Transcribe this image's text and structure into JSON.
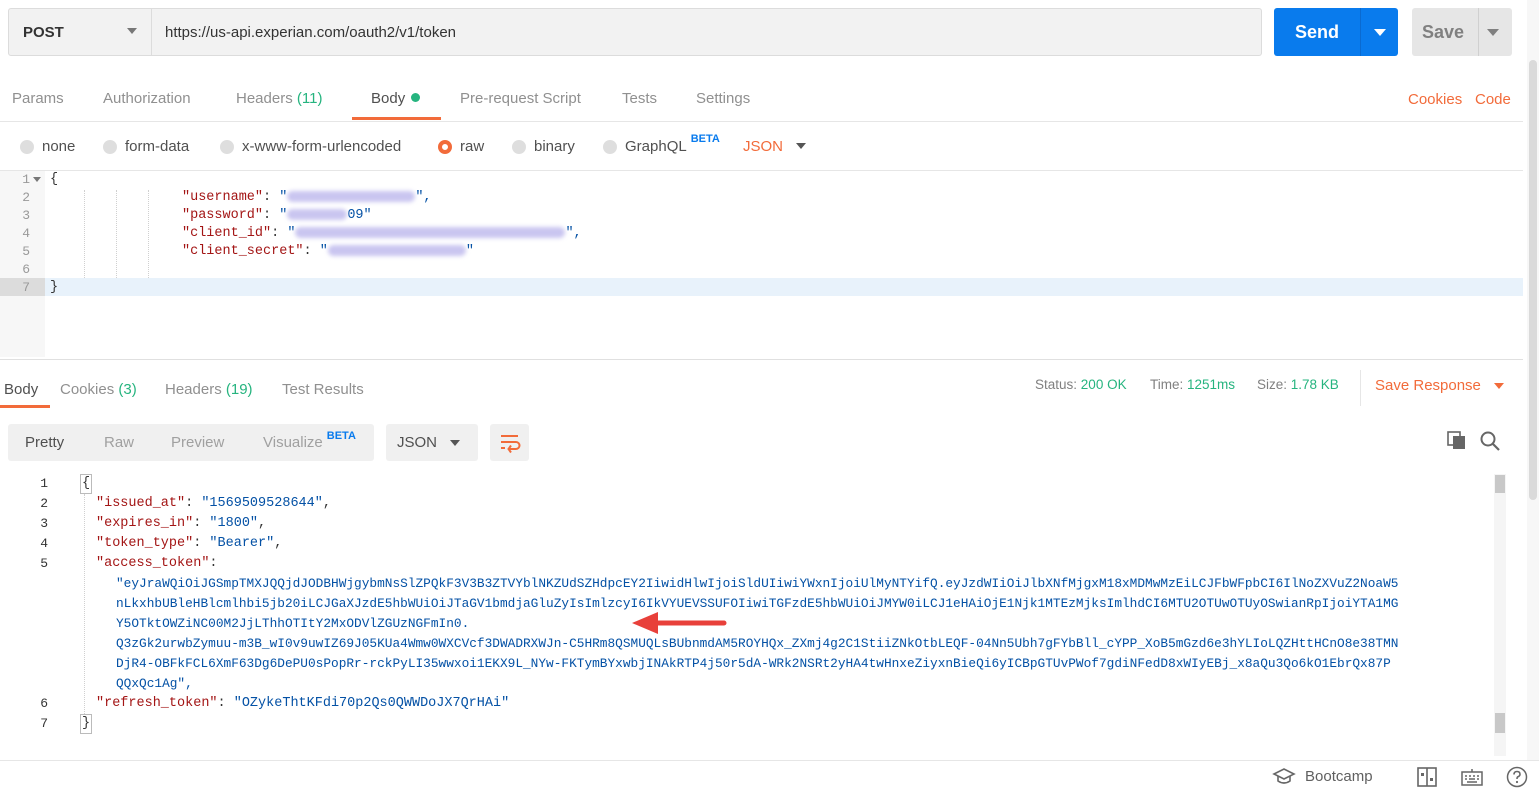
{
  "request": {
    "method": "POST",
    "url": "https://us-api.experian.com/oauth2/v1/token",
    "send_label": "Send",
    "save_label": "Save"
  },
  "request_tabs": [
    {
      "label": "Params"
    },
    {
      "label": "Authorization"
    },
    {
      "label": "Headers",
      "count": "(11)"
    },
    {
      "label": "Body"
    },
    {
      "label": "Pre-request Script"
    },
    {
      "label": "Tests"
    },
    {
      "label": "Settings"
    }
  ],
  "right_links": {
    "cookies": "Cookies",
    "code": "Code"
  },
  "body_types": {
    "none": "none",
    "form_data": "form-data",
    "urlencoded": "x-www-form-urlencoded",
    "raw": "raw",
    "binary": "binary",
    "graphql": "GraphQL",
    "beta": "BETA",
    "raw_format": "JSON"
  },
  "request_body": {
    "line_numbers": [
      "1",
      "2",
      "3",
      "4",
      "5",
      "6",
      "7"
    ],
    "open_brace": "{",
    "close_brace": "}",
    "keys": [
      "\"username\"",
      "\"password\"",
      "\"client_id\"",
      "\"client_secret\""
    ],
    "password_visible": "09\""
  },
  "response_tabs": [
    {
      "label": "Body"
    },
    {
      "label": "Cookies",
      "count": "(3)"
    },
    {
      "label": "Headers",
      "count": "(19)"
    },
    {
      "label": "Test Results"
    }
  ],
  "response_meta": {
    "status_label": "Status:",
    "status": "200 OK",
    "time_label": "Time:",
    "time": "1251ms",
    "size_label": "Size:",
    "size": "1.78 KB",
    "save_response": "Save Response"
  },
  "view_modes": {
    "pretty": "Pretty",
    "raw": "Raw",
    "preview": "Preview",
    "visualize": "Visualize",
    "beta": "BETA",
    "format": "JSON"
  },
  "response_body": {
    "line_numbers": [
      "1",
      "2",
      "3",
      "4",
      "5",
      "6",
      "7"
    ],
    "open_brace": "{",
    "close_brace": "}",
    "issued_at_key": "\"issued_at\"",
    "issued_at": "\"1569509528644\"",
    "expires_in_key": "\"expires_in\"",
    "expires_in": "\"1800\"",
    "token_type_key": "\"token_type\"",
    "token_type": "\"Bearer\"",
    "access_token_key": "\"access_token\"",
    "access_token_lines": [
      "\"eyJraWQiOiJGSmpTMXJQQjdJODBHWjgybmNsSlZPQkF3V3B3ZTVYblNKZUdSZHdpcEY2IiwidHlwIjoiSldUIiwiYWxnIjoiUlMyNTYifQ.eyJzdWIiOiJlbXNfMjgxM18xMDMwMzEiLCJFbWFpbCI6IlNoZXVuZ2NoaW5",
      "nLkxhbUBleHBlcmlhbi5jb20iLCJGaXJzdE5hbWUiOiJTaGV1bmdjaGluZyIsImlzcyI6IkVYUEVSSUFOIiwiTGFzdE5hbWUiOiJMYW0iLCJ1eHAiOjE1Njk1MTEzMjksImlhdCI6MTU2OTUwOTUyOSwianRpIjoiYTA1MG",
      "Y5OTktOWZiNC00M2JjLThhOTItY2MxODVlZGUzNGFmIn0.",
      "Q3zGk2urwbZymuu-m3B_wI0v9uwIZ69J05KUa4Wmw0WXCVcf3DWADRXWJn-C5HRm8QSMUQLsBUbnmdAM5ROYHQx_ZXmj4g2C1StiiZNkOtbLEQF-04Nn5Ubh7gFYbBll_cYPP_XoB5mGzd6e3hYLIoLQZHttHCnO8e38TMN",
      "DjR4-OBFkFCL6XmF63Dg6DePU0sPopRr-rckPyLI35wwxoi1EKX9L_NYw-FKTymBYxwbjINAkRTP4j50r5dA-WRk2NSRt2yHA4twHnxeZiyxnBieQi6yICBpGTUvPWof7gdiNFedD8xWIyEBj_x8aQu3Qo6kO1EbrQx87P",
      "QQxQc1Ag\","
    ],
    "refresh_token_key": "\"refresh_token\"",
    "refresh_token": "\"OZykeThtKFdi70p2Qs0QWWDoJX7QrHAi\""
  },
  "statusbar": {
    "bootcamp": "Bootcamp"
  },
  "colors": {
    "accent": "#f26b3a",
    "primary": "#097bed",
    "success": "#26b47f"
  }
}
